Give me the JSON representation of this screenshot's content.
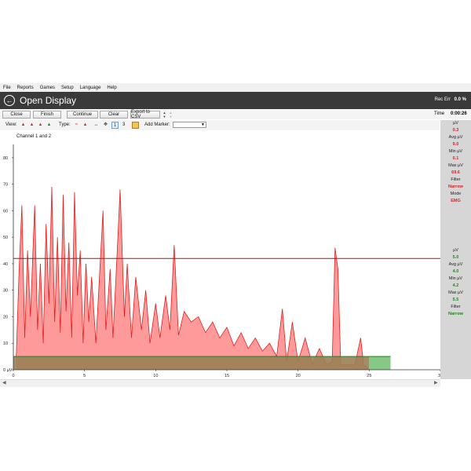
{
  "menu": [
    "File",
    "Reports",
    "Games",
    "Setup",
    "Language",
    "Help"
  ],
  "window": {
    "title": "Open Display",
    "rec_err_label": "Rec Err",
    "rec_err_value": "0.0 %"
  },
  "toolbar": {
    "close": "Close",
    "finish": "Finish",
    "continue": "Continue",
    "clear": "Clear",
    "export": "Export to CSV",
    "time_label": "Time",
    "time_value": "0:00:26"
  },
  "toolbar2": {
    "view_label": "View:",
    "type_label": "Type:",
    "channel_count": "3",
    "add_marker": "Add Marker:"
  },
  "channel_title": "Channel 1 and 2",
  "channel1": {
    "uv_label": "µV",
    "uv": "0.3",
    "avg_label": "Avg µV",
    "avg": "9.0",
    "min_label": "Min µV",
    "min": "0.1",
    "max_label": "Max µV",
    "max": "69.6",
    "filter_label": "Filter",
    "filter": "Narrow",
    "mode_label": "Mode",
    "mode": "EMG"
  },
  "channel2": {
    "uv_label": "µV",
    "uv": "5.0",
    "avg_label": "Avg µV",
    "avg": "4.0",
    "min_label": "Min µV",
    "min": "4.2",
    "max_label": "Max µV",
    "max": "5.5",
    "filter_label": "Filter",
    "filter": "Narrow"
  },
  "colors": {
    "ch1_line": "#e02020",
    "ch1_fill": "#ff9a9a",
    "ch2_line": "#2a7a2a",
    "ch2_fill": "#86c986",
    "overlap": "#9a7f55",
    "threshold": "#b01010"
  },
  "chart_data": {
    "type": "area",
    "xlim": [
      0,
      30
    ],
    "ylim": [
      0,
      85
    ],
    "xticks": [
      0,
      5,
      10,
      15,
      20,
      25,
      30
    ],
    "yticks": [
      0,
      10,
      20,
      30,
      40,
      50,
      60,
      70,
      80
    ],
    "ytick_labels": [
      "0 µV",
      "10",
      "20",
      "30",
      "40",
      "50",
      "60",
      "70",
      "80"
    ],
    "threshold": 42,
    "series": [
      {
        "key": "ch1",
        "x_end": 25.0,
        "points": [
          [
            0.2,
            4
          ],
          [
            0.4,
            37
          ],
          [
            0.6,
            62
          ],
          [
            0.8,
            12
          ],
          [
            1.0,
            45
          ],
          [
            1.2,
            20
          ],
          [
            1.5,
            62
          ],
          [
            1.7,
            15
          ],
          [
            1.9,
            40
          ],
          [
            2.1,
            10
          ],
          [
            2.3,
            55
          ],
          [
            2.5,
            25
          ],
          [
            2.7,
            69
          ],
          [
            2.9,
            18
          ],
          [
            3.1,
            50
          ],
          [
            3.3,
            14
          ],
          [
            3.5,
            66
          ],
          [
            3.7,
            22
          ],
          [
            3.9,
            48
          ],
          [
            4.1,
            12
          ],
          [
            4.3,
            67
          ],
          [
            4.5,
            28
          ],
          [
            4.7,
            45
          ],
          [
            4.9,
            10
          ],
          [
            5.1,
            40
          ],
          [
            5.3,
            18
          ],
          [
            5.5,
            35
          ],
          [
            5.8,
            10
          ],
          [
            6.0,
            30
          ],
          [
            6.3,
            60
          ],
          [
            6.5,
            15
          ],
          [
            6.8,
            38
          ],
          [
            7.0,
            12
          ],
          [
            7.3,
            45
          ],
          [
            7.5,
            68
          ],
          [
            7.8,
            20
          ],
          [
            8.0,
            40
          ],
          [
            8.3,
            12
          ],
          [
            8.6,
            35
          ],
          [
            9.0,
            15
          ],
          [
            9.3,
            30
          ],
          [
            9.6,
            10
          ],
          [
            10.0,
            25
          ],
          [
            10.3,
            12
          ],
          [
            10.7,
            28
          ],
          [
            11.0,
            15
          ],
          [
            11.3,
            47
          ],
          [
            11.6,
            13
          ],
          [
            12.0,
            22
          ],
          [
            12.5,
            18
          ],
          [
            13.0,
            20
          ],
          [
            13.5,
            14
          ],
          [
            14.0,
            18
          ],
          [
            14.5,
            12
          ],
          [
            15.0,
            16
          ],
          [
            15.5,
            9
          ],
          [
            16.0,
            14
          ],
          [
            16.5,
            8
          ],
          [
            17.0,
            12
          ],
          [
            17.5,
            7
          ],
          [
            18.0,
            10
          ],
          [
            18.5,
            5
          ],
          [
            18.9,
            23
          ],
          [
            19.2,
            3
          ],
          [
            19.6,
            18
          ],
          [
            20.0,
            3
          ],
          [
            20.5,
            12
          ],
          [
            21.0,
            2
          ],
          [
            21.5,
            8
          ],
          [
            22.0,
            2
          ],
          [
            22.4,
            3
          ],
          [
            22.6,
            46
          ],
          [
            22.8,
            38
          ],
          [
            23.0,
            2
          ],
          [
            23.5,
            2
          ],
          [
            24.0,
            2
          ],
          [
            24.4,
            12
          ],
          [
            24.6,
            2
          ],
          [
            25.0,
            0
          ]
        ]
      },
      {
        "key": "ch2",
        "x_end": 26.5,
        "level": 5
      }
    ]
  }
}
